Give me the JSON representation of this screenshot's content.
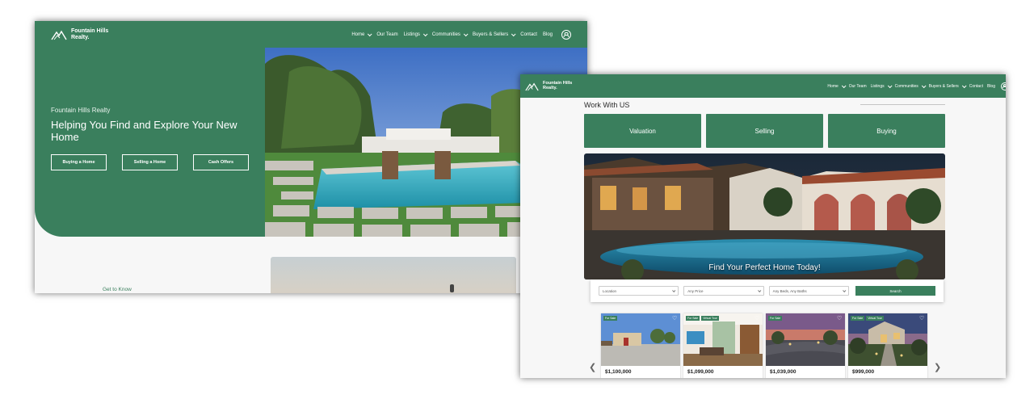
{
  "brand": {
    "name_line1": "Fountain Hills",
    "name_line2": "Realty."
  },
  "nav": {
    "items": [
      {
        "label": "Home",
        "dropdown": true
      },
      {
        "label": "Our Team",
        "dropdown": false
      },
      {
        "label": "Listings",
        "dropdown": true
      },
      {
        "label": "Communities",
        "dropdown": true
      },
      {
        "label": "Buyers & Sellers",
        "dropdown": true
      },
      {
        "label": "Contact",
        "dropdown": false
      },
      {
        "label": "Blog",
        "dropdown": false
      }
    ]
  },
  "window1": {
    "hero": {
      "eyebrow": "Fountain Hills Realty",
      "title": "Helping You Find and Explore Your New Home",
      "buttons": [
        "Buying a Home",
        "Selling a Home",
        "Cash Offers"
      ]
    },
    "section_label": "Get to Know"
  },
  "window2": {
    "work_heading": "Work With US",
    "tiles": [
      "Valuation",
      "Selling",
      "Buying"
    ],
    "hero_title": "Find Your Perfect Home Today!",
    "search": {
      "location": "Location",
      "price": "Any Price",
      "beds_baths": "Any Beds, Any Baths",
      "button": "Search"
    },
    "listings": [
      {
        "badges": [
          "For Sale"
        ],
        "price": "$1,100,000"
      },
      {
        "badges": [
          "For Sale",
          "Virtual Tour"
        ],
        "price": "$1,099,000"
      },
      {
        "badges": [
          "For Sale"
        ],
        "price": "$1,039,000"
      },
      {
        "badges": [
          "For Sale",
          "Virtual Tour"
        ],
        "price": "$999,000"
      }
    ]
  },
  "colors": {
    "brand_green": "#3a7f5d",
    "page_bg": "#f7f7f7"
  },
  "icons": [
    "mountain-logo-icon",
    "chevron-down-icon",
    "user-icon",
    "heart-icon",
    "chevron-left-icon",
    "chevron-right-icon"
  ]
}
